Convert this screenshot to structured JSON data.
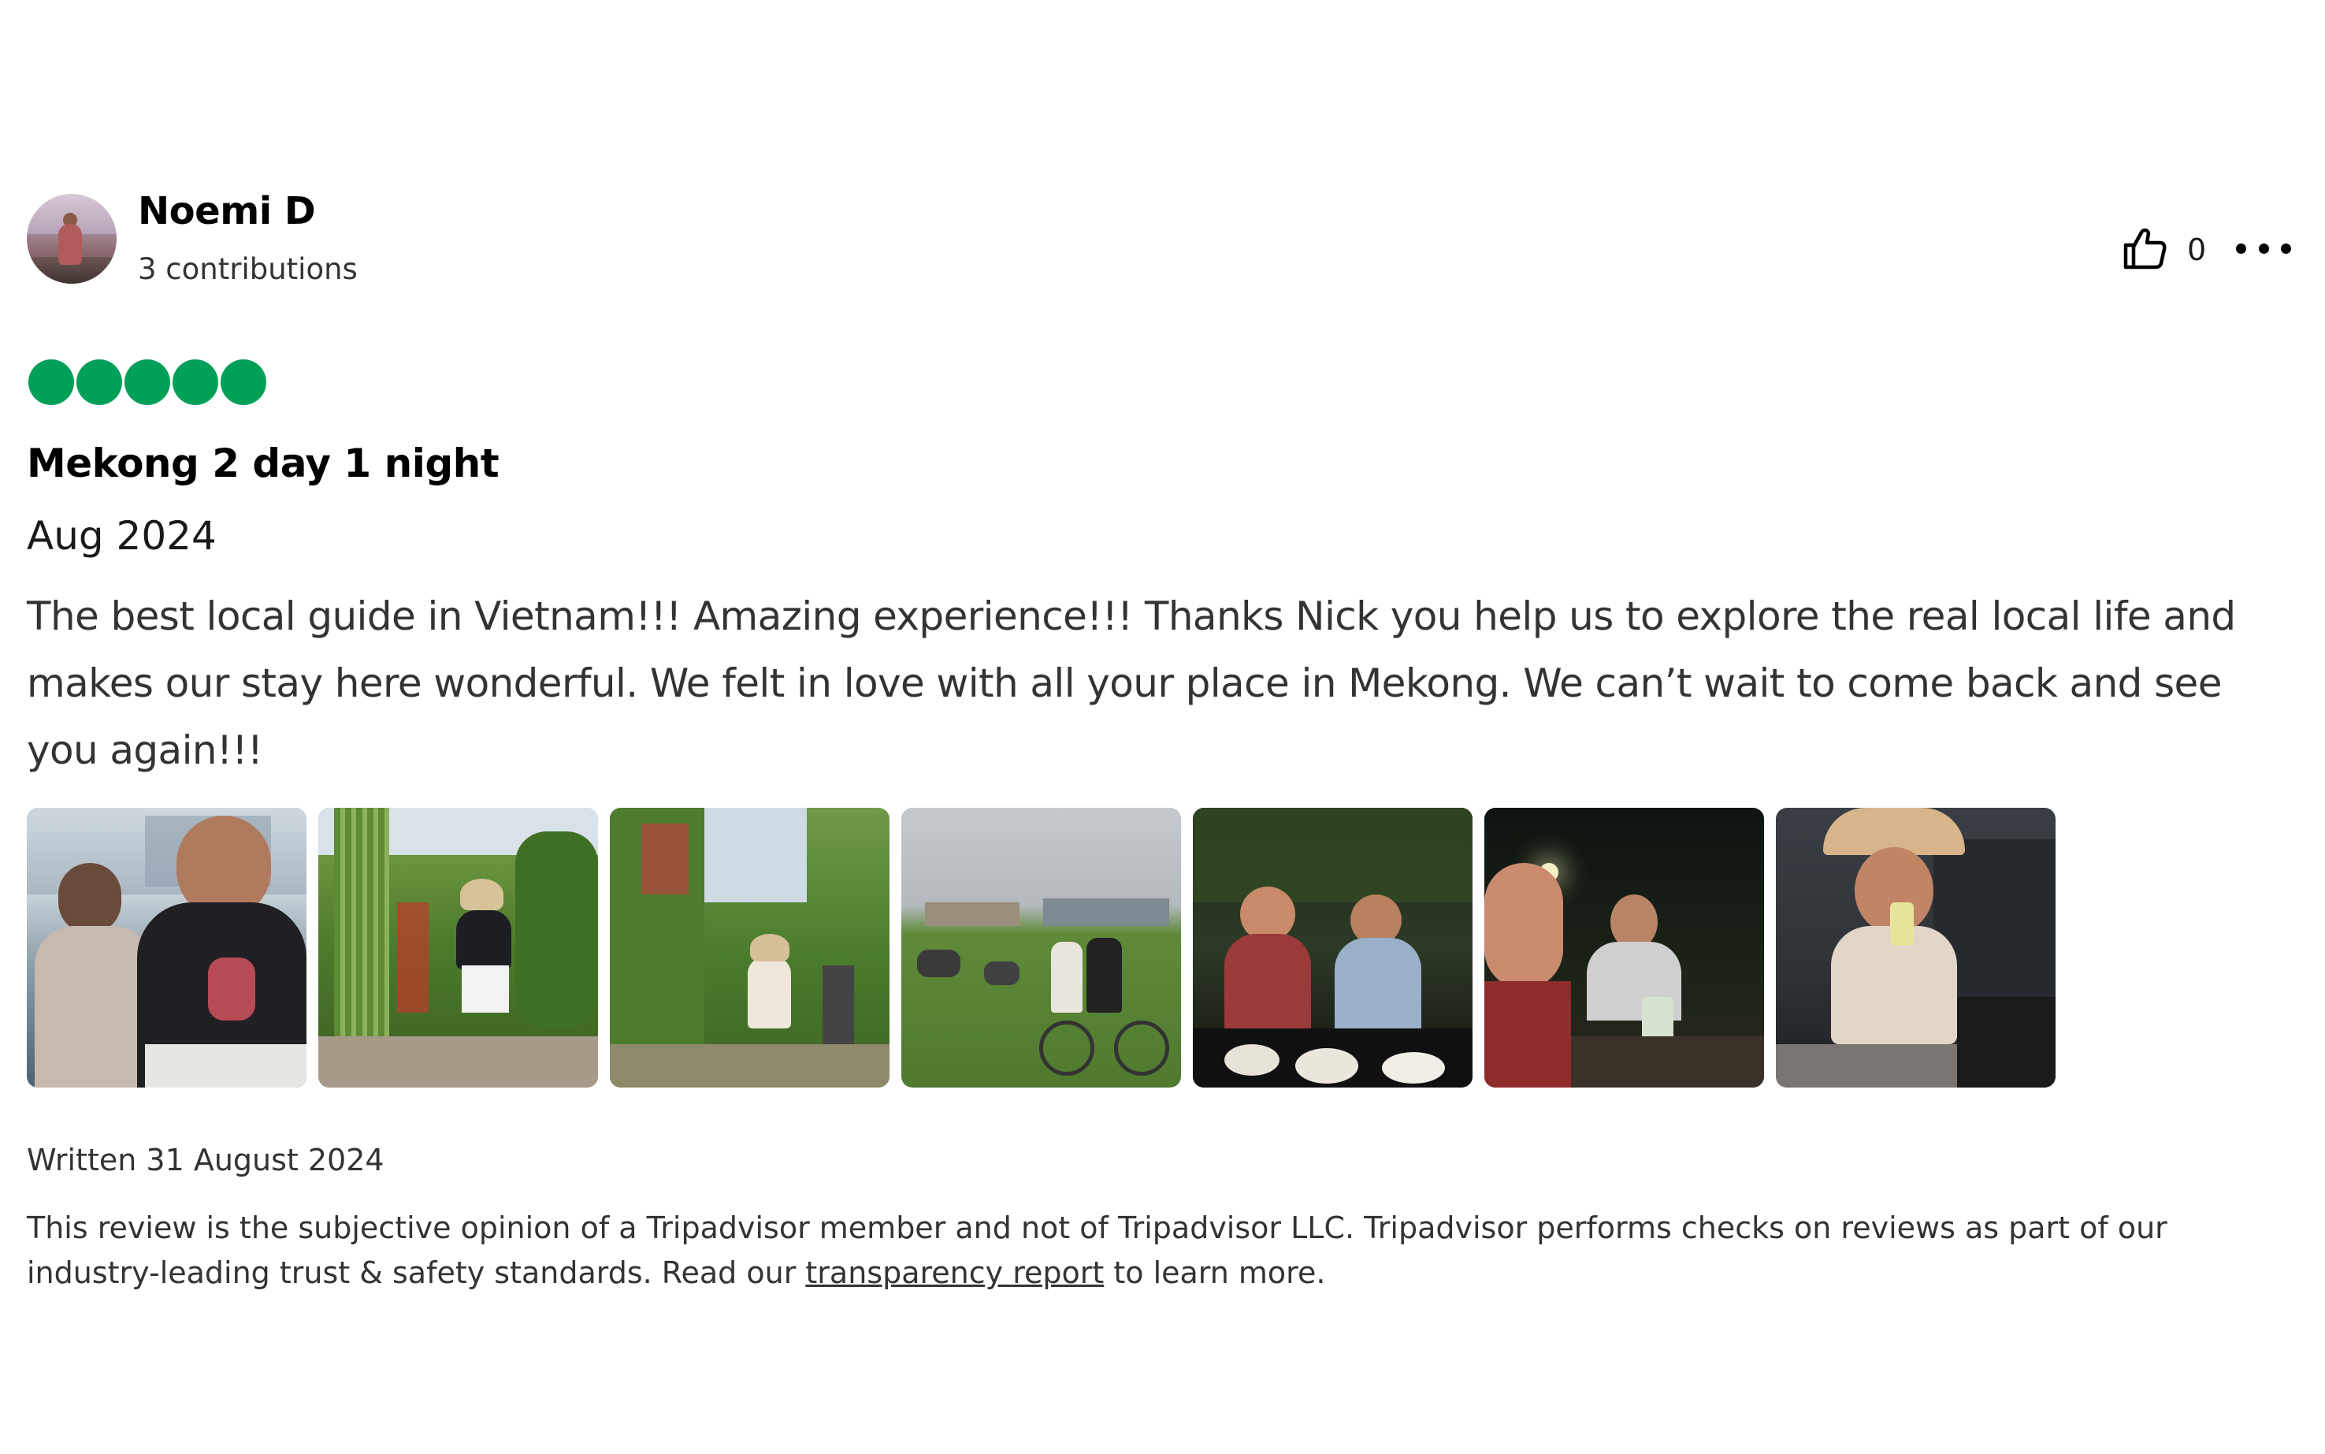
{
  "review": {
    "author": {
      "name": "Noemi D",
      "contributions": "3 contributions",
      "avatar": "profile-photo"
    },
    "helpful": {
      "icon": "thumbs-up-icon",
      "count": "0"
    },
    "more_menu_icon": "more-options-icon",
    "rating": {
      "value": 5,
      "max": 5,
      "color": "#00a058"
    },
    "title": "Mekong 2 day 1 night",
    "trip_date": "Aug 2024",
    "body": "The best local guide in Vietnam!!! Amazing experience!!! Thanks Nick you help us to explore the real local life and makes our stay here wonderful. We felt in love with all your place in Mekong. We can’t wait to come back and see you again!!!",
    "photos_count": 7,
    "written_date": "Written 31 August 2024",
    "disclaimer": {
      "text_before": "This review is the subjective opinion of a Tripadvisor member and not of Tripadvisor LLC. Tripadvisor performs checks on reviews as part of our industry-leading trust & safety standards. Read our ",
      "link_text": "transparency report",
      "text_after": " to learn more."
    }
  }
}
